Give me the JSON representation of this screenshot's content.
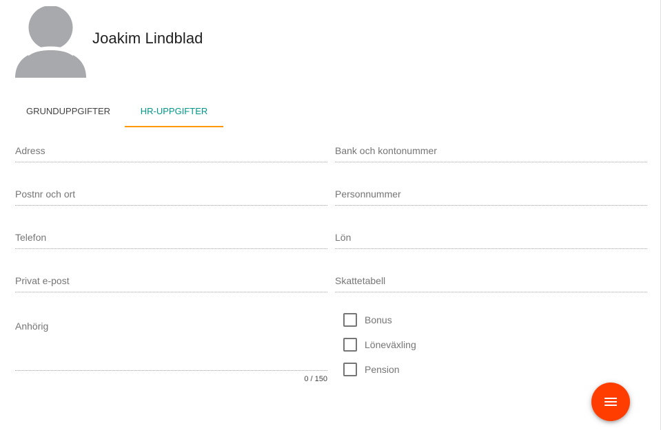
{
  "profile": {
    "name": "Joakim Lindblad",
    "avatar_icon": "person-placeholder-icon"
  },
  "tabs": [
    {
      "label": "GRUNDUPPGIFTER",
      "active": false
    },
    {
      "label": "HR-UPPGIFTER",
      "active": true
    }
  ],
  "form": {
    "left": {
      "address_label": "Adress",
      "postal_label": "Postnr och ort",
      "phone_label": "Telefon",
      "email_label": "Privat e-post",
      "relative_label": "Anhörig",
      "relative_counter": "0 / 150"
    },
    "right": {
      "bank_label": "Bank och kontonummer",
      "ssn_label": "Personnummer",
      "salary_label": "Lön",
      "tax_label": "Skattetabell"
    },
    "checkboxes": [
      {
        "label": "Bonus",
        "checked": false
      },
      {
        "label": "Löneväxling",
        "checked": false
      },
      {
        "label": "Pension",
        "checked": false
      }
    ]
  },
  "fab": {
    "icon": "menu-icon"
  },
  "colors": {
    "accent_tab_text": "#009688",
    "tab_indicator": "#ff9800",
    "fab": "#ff3d00",
    "avatar": "#a7a9ac"
  }
}
